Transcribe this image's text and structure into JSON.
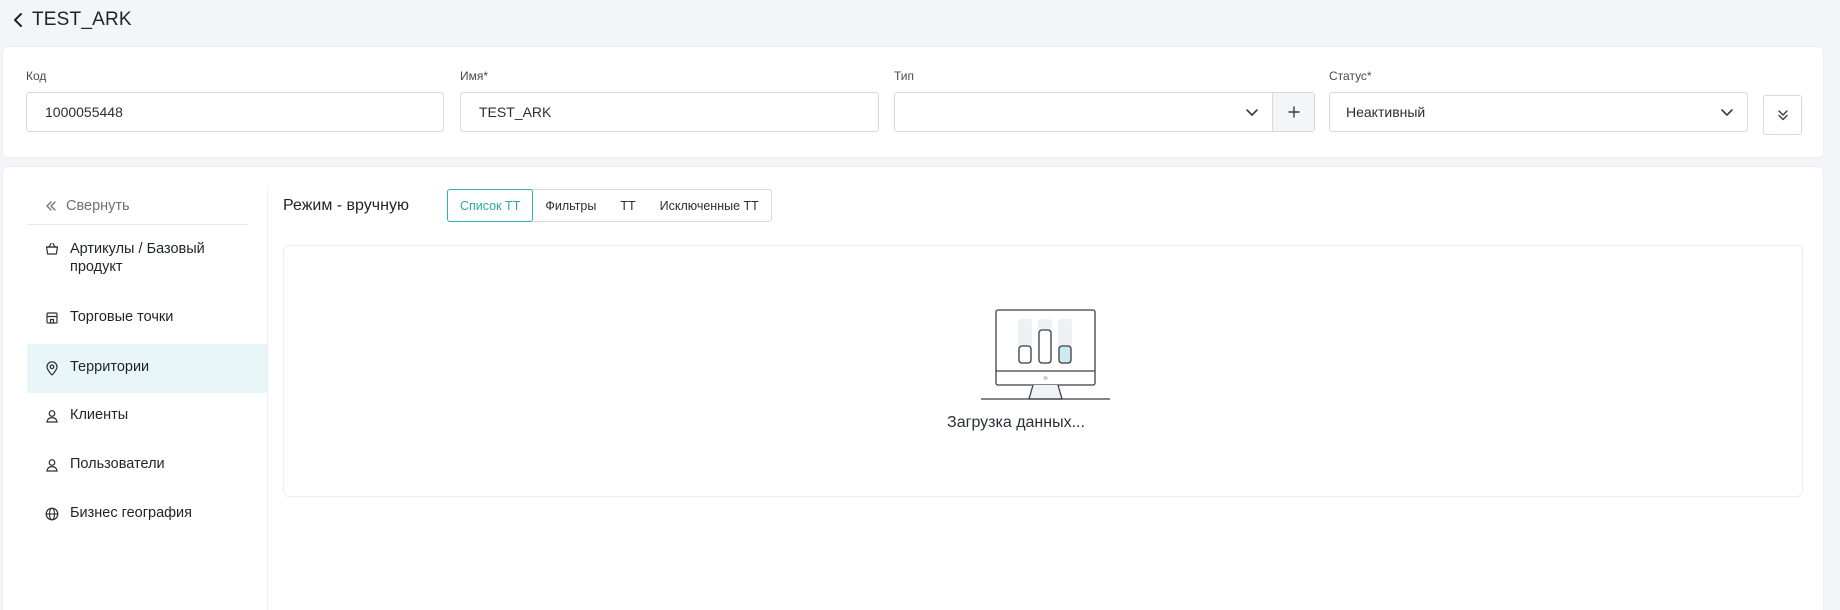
{
  "header": {
    "back_icon": "chevron-left-icon",
    "title": "TEST_ARK"
  },
  "form": {
    "code": {
      "label": "Код",
      "value": "1000055448"
    },
    "name": {
      "label": "Имя*",
      "value": "TEST_ARK"
    },
    "type": {
      "label": "Тип",
      "value": "",
      "chevron_icon": "chevron-down-icon",
      "add_icon": "plus-icon"
    },
    "status": {
      "label": "Статус*",
      "value": "Неактивный",
      "chevron_icon": "chevron-down-icon"
    },
    "expand_icon": "double-chevron-down-icon"
  },
  "sidebar": {
    "collapse_label": "Свернуть",
    "collapse_icon": "double-chevron-left-icon",
    "items": [
      {
        "label": "Артикулы / Базовый продукт",
        "icon": "basket-icon",
        "active": false
      },
      {
        "label": "Торговые точки",
        "icon": "store-icon",
        "active": false
      },
      {
        "label": "Территории",
        "icon": "location-pin-icon",
        "active": true
      },
      {
        "label": "Клиенты",
        "icon": "user-icon",
        "active": false
      },
      {
        "label": "Пользователи",
        "icon": "user-icon",
        "active": false
      },
      {
        "label": "Бизнес география",
        "icon": "globe-icon",
        "active": false
      }
    ]
  },
  "main": {
    "mode_title": "Режим - вручную",
    "tabs": [
      {
        "label": "Список ТТ",
        "active": true
      },
      {
        "label": "Фильтры",
        "active": false
      },
      {
        "label": "ТТ",
        "active": false
      },
      {
        "label": "Исключенные ТТ",
        "active": false
      }
    ],
    "loading_text": "Загрузка данных...",
    "loading_icon": "monitor-chart-icon"
  },
  "colors": {
    "accent": "#2fb3b9",
    "active_bg": "#e8f6f7",
    "page_bg": "#f4f5f9",
    "border": "#d6d9de"
  }
}
